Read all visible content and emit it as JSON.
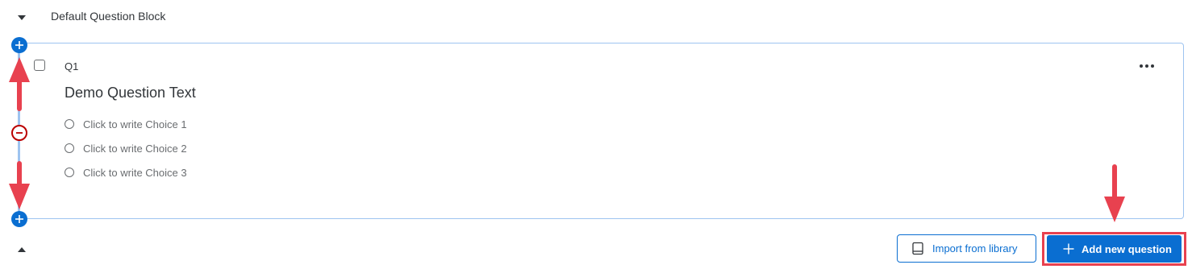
{
  "block": {
    "title": "Default Question Block",
    "collapse_icon": "caret-down-icon",
    "expand_icon": "caret-up-icon"
  },
  "question": {
    "number": "Q1",
    "text": "Demo Question Text",
    "menu_icon": "more-horizontal-icon",
    "choices": [
      "Click to write Choice 1",
      "Click to write Choice 2",
      "Click to write Choice 3"
    ]
  },
  "controls": {
    "add_above_icon": "plus-circle-icon",
    "remove_icon": "minus-circle-icon",
    "add_below_icon": "plus-circle-icon"
  },
  "footer": {
    "import_label": "Import from library",
    "import_icon": "book-icon",
    "add_label": "Add new question",
    "add_icon": "plus-icon"
  },
  "colors": {
    "primary": "#0a6ed1",
    "card_border": "#9ec4f0",
    "remove": "#bb0000",
    "annotation": "#e8414f",
    "text": "#32363a",
    "muted": "#6a6d70"
  }
}
